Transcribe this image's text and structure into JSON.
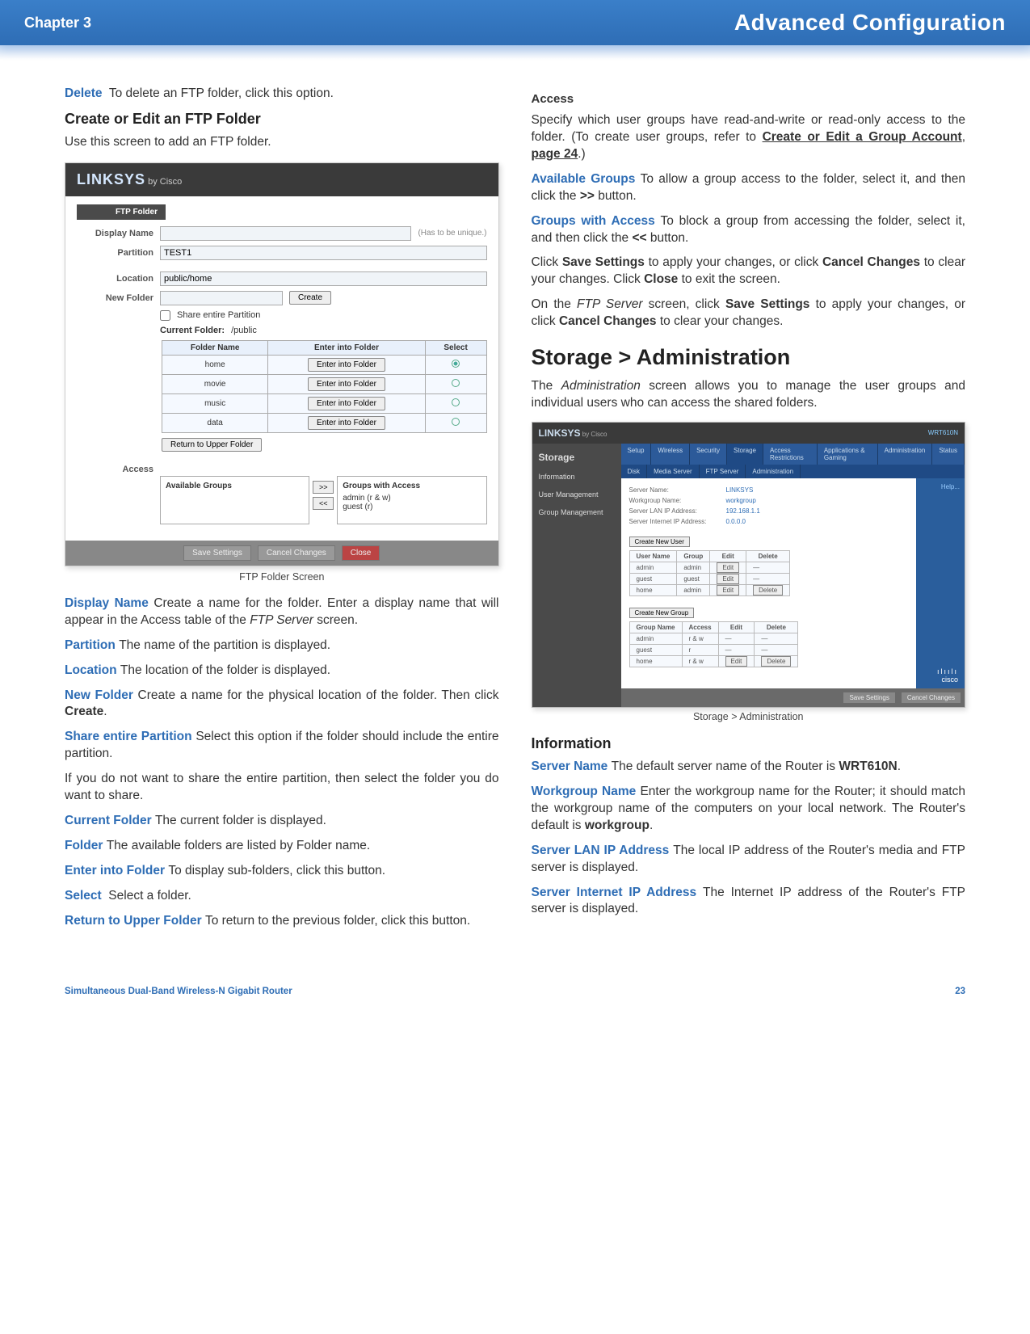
{
  "header": {
    "chapter": "Chapter 3",
    "title": "Advanced Configuration"
  },
  "left": {
    "delete": {
      "term": "Delete",
      "text": "To delete an FTP folder, click this option."
    },
    "create_heading": "Create or Edit an FTP Folder",
    "create_intro": "Use this screen to add an FTP folder.",
    "ftp_screen": {
      "brand": "LINKSYS",
      "bycisco": "by Cisco",
      "section_title": "FTP Folder",
      "labels": {
        "display_name": "Display Name",
        "display_hint": "(Has to be unique.)",
        "partition": "Partition",
        "partition_value": "TEST1",
        "location": "Location",
        "location_value": "public/home",
        "new_folder": "New Folder",
        "create_btn": "Create",
        "share_chk": "Share entire Partition",
        "current_folder_lbl": "Current Folder:",
        "current_folder_val": "/public",
        "col_folder": "Folder Name",
        "col_enter": "Enter into Folder",
        "col_select": "Select",
        "rows": [
          {
            "name": "home",
            "btn": "Enter into Folder"
          },
          {
            "name": "movie",
            "btn": "Enter into Folder"
          },
          {
            "name": "music",
            "btn": "Enter into Folder"
          },
          {
            "name": "data",
            "btn": "Enter into Folder"
          }
        ],
        "return_btn": "Return to Upper Folder",
        "access_label": "Access",
        "available_groups": "Available Groups",
        "groups_with_access": "Groups with Access",
        "ga_line1": "admin (r & w)",
        "ga_line2": "guest (r)",
        "btn_right": ">>",
        "btn_left": "<<",
        "save": "Save Settings",
        "cancel": "Cancel Changes",
        "close": "Close"
      }
    },
    "caption1": "FTP Folder Screen",
    "items": {
      "display_name": {
        "term": "Display Name",
        "text": "Create a name for the folder. Enter a display name that will appear in the Access table of the ",
        "tail_italic": "FTP Server",
        "tail2": " screen."
      },
      "partition": {
        "term": "Partition",
        "text": "The name of the partition is displayed."
      },
      "location": {
        "term": "Location",
        "text": "The location of the folder is displayed."
      },
      "new_folder": {
        "term": "New Folder",
        "text": "Create a name for the physical location of the folder. Then click ",
        "bold": "Create",
        "tail": "."
      },
      "share": {
        "term": "Share entire Partition",
        "text": "Select this option if the folder should include the entire partition."
      },
      "share_extra": "If you do not want to share the entire partition, then select the folder you do want to share.",
      "current_folder": {
        "term": "Current Folder",
        "text": "The current folder is displayed."
      },
      "folder": {
        "term": "Folder",
        "text": "The available folders are listed by Folder name."
      },
      "enter": {
        "term": "Enter into Folder",
        "text": "To display sub-folders, click this button."
      },
      "select": {
        "term": "Select",
        "text": " Select a folder."
      },
      "return": {
        "term": "Return to Upper Folder",
        "text": "To return to the previous folder, click this button."
      }
    }
  },
  "right": {
    "access_heading": "Access",
    "access_intro_pre": "Specify which user groups have read-and-write or read-only access to the folder. (To create user groups, refer to ",
    "access_link": "Create or Edit a Group Account",
    "access_intro_mid": ", ",
    "access_page": "page 24",
    "access_intro_post": ".)",
    "available_groups": {
      "term": "Available Groups",
      "text": "To allow a group access to the folder, select it, and then click the ",
      "bold": ">>",
      "tail": " button."
    },
    "groups_with_access": {
      "term": "Groups with Access",
      "text": "To block a group from accessing the folder, select it, and then click the ",
      "bold": "<<",
      "tail": " button."
    },
    "save_line_pre": "Click ",
    "save_b1": "Save Settings",
    "save_mid": " to apply your changes, or click ",
    "save_b2": "Cancel Changes",
    "save_mid2": " to clear your changes. Click ",
    "save_b3": "Close",
    "save_post": " to exit the screen.",
    "ftp_line_pre": "On the ",
    "ftp_it": "FTP Server",
    "ftp_mid": " screen, click ",
    "ftp_b1": "Save Settings",
    "ftp_mid2": " to apply your changes, or click ",
    "ftp_b2": "Cancel Changes",
    "ftp_post": " to clear your changes.",
    "storage_heading": "Storage > Administration",
    "storage_intro_pre": "The ",
    "storage_it": "Administration",
    "storage_intro_post": " screen allows you to manage the user groups and individual users who can access the shared folders.",
    "storage_thumb": {
      "brand": "LINKSYS",
      "bycisco": "by Cisco",
      "model": "WRT610N",
      "sidebar_title": "Storage",
      "tabs": [
        "Setup",
        "Wireless",
        "Security",
        "Storage",
        "Access Restrictions",
        "Applications & Gaming",
        "Administration",
        "Status"
      ],
      "subtabs": [
        "Disk",
        "Media Server",
        "FTP Server",
        "Administration"
      ],
      "side_items": [
        "Information",
        "User Management",
        "Group Management"
      ],
      "info": {
        "server_name_k": "Server Name:",
        "server_name_v": "LINKSYS",
        "workgroup_k": "Workgroup Name:",
        "workgroup_v": "workgroup",
        "lan_k": "Server LAN IP Address:",
        "lan_v": "192.168.1.1",
        "wan_k": "Server Internet IP Address:",
        "wan_v": "0.0.0.0"
      },
      "create_user_btn": "Create New User",
      "user_cols": [
        "User Name",
        "Group",
        "Edit",
        "Delete"
      ],
      "user_rows": [
        {
          "name": "admin",
          "group": "admin",
          "edit": "Edit",
          "del": "—"
        },
        {
          "name": "guest",
          "group": "guest",
          "edit": "Edit",
          "del": "—"
        },
        {
          "name": "home",
          "group": "admin",
          "edit": "Edit",
          "del": "Delete"
        }
      ],
      "create_group_btn": "Create New Group",
      "group_cols": [
        "Group Name",
        "Access",
        "Edit",
        "Delete"
      ],
      "group_rows": [
        {
          "name": "admin",
          "access": "r & w",
          "edit": "—",
          "del": "—"
        },
        {
          "name": "guest",
          "access": "r",
          "edit": "—",
          "del": "—"
        },
        {
          "name": "home",
          "access": "r & w",
          "edit": "Edit",
          "del": "Delete"
        }
      ],
      "help": "Help...",
      "save": "Save Settings",
      "cancel": "Cancel Changes",
      "cisco": "cisco"
    },
    "caption2": "Storage > Administration",
    "info_heading": "Information",
    "server_name": {
      "term": "Server Name",
      "text": "The default server name of the Router is ",
      "bold": "WRT610N",
      "tail": "."
    },
    "workgroup": {
      "term": "Workgroup Name",
      "text": "Enter the workgroup name for the Router; it should match the workgroup name of the computers on your local network. The Router's default is ",
      "bold": "workgroup",
      "tail": "."
    },
    "lan": {
      "term": "Server LAN IP Address",
      "text": "The local IP address of the Router's media and FTP server is displayed."
    },
    "wan": {
      "term": "Server Internet IP Address",
      "text": "The Internet IP address of the Router's FTP server is displayed."
    }
  },
  "footer": {
    "product": "Simultaneous Dual-Band Wireless-N Gigabit Router",
    "page": "23"
  }
}
